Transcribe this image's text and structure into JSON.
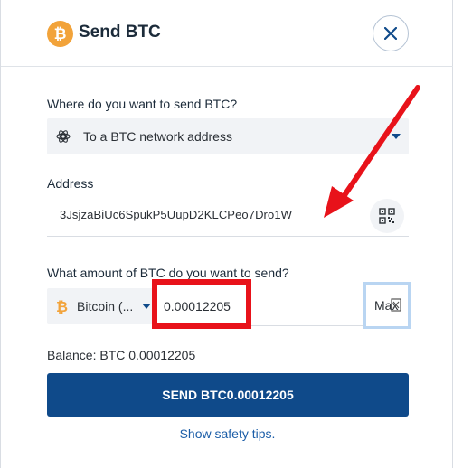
{
  "header": {
    "title": "Send BTC",
    "logo_glyph": "₿"
  },
  "destination": {
    "question": "Where do you want to send BTC?",
    "selected": "To a BTC network address"
  },
  "address": {
    "label": "Address",
    "value": "3JsjzaBiUc6SpukP5UupD2KLCPeo7Dro1W"
  },
  "amount": {
    "question": "What amount of BTC do you want to send?",
    "currency": "Bitcoin (...",
    "value": "0.00012205",
    "max_label": "Max"
  },
  "balance": "Balance: BTC 0.00012205",
  "send_button": "SEND BTC0.00012205",
  "safety_tips": "Show safety tips.",
  "colors": {
    "primary": "#0f4a8a",
    "bitcoin": "#f2a33a",
    "annotation": "#e8121a",
    "link": "#1c5ea8"
  }
}
